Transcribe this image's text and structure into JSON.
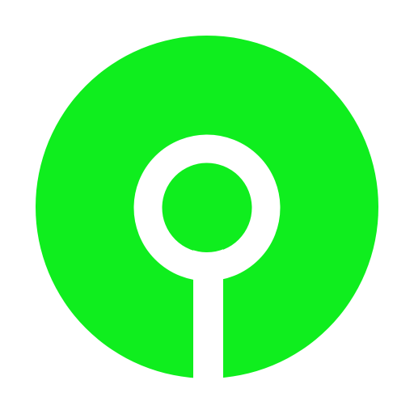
{
  "icon": {
    "name": "keyhole-logo-icon",
    "colors": {
      "disc": "#0FEE1E",
      "symbol": "#FFFFFF",
      "background": "#FFFFFF"
    }
  }
}
